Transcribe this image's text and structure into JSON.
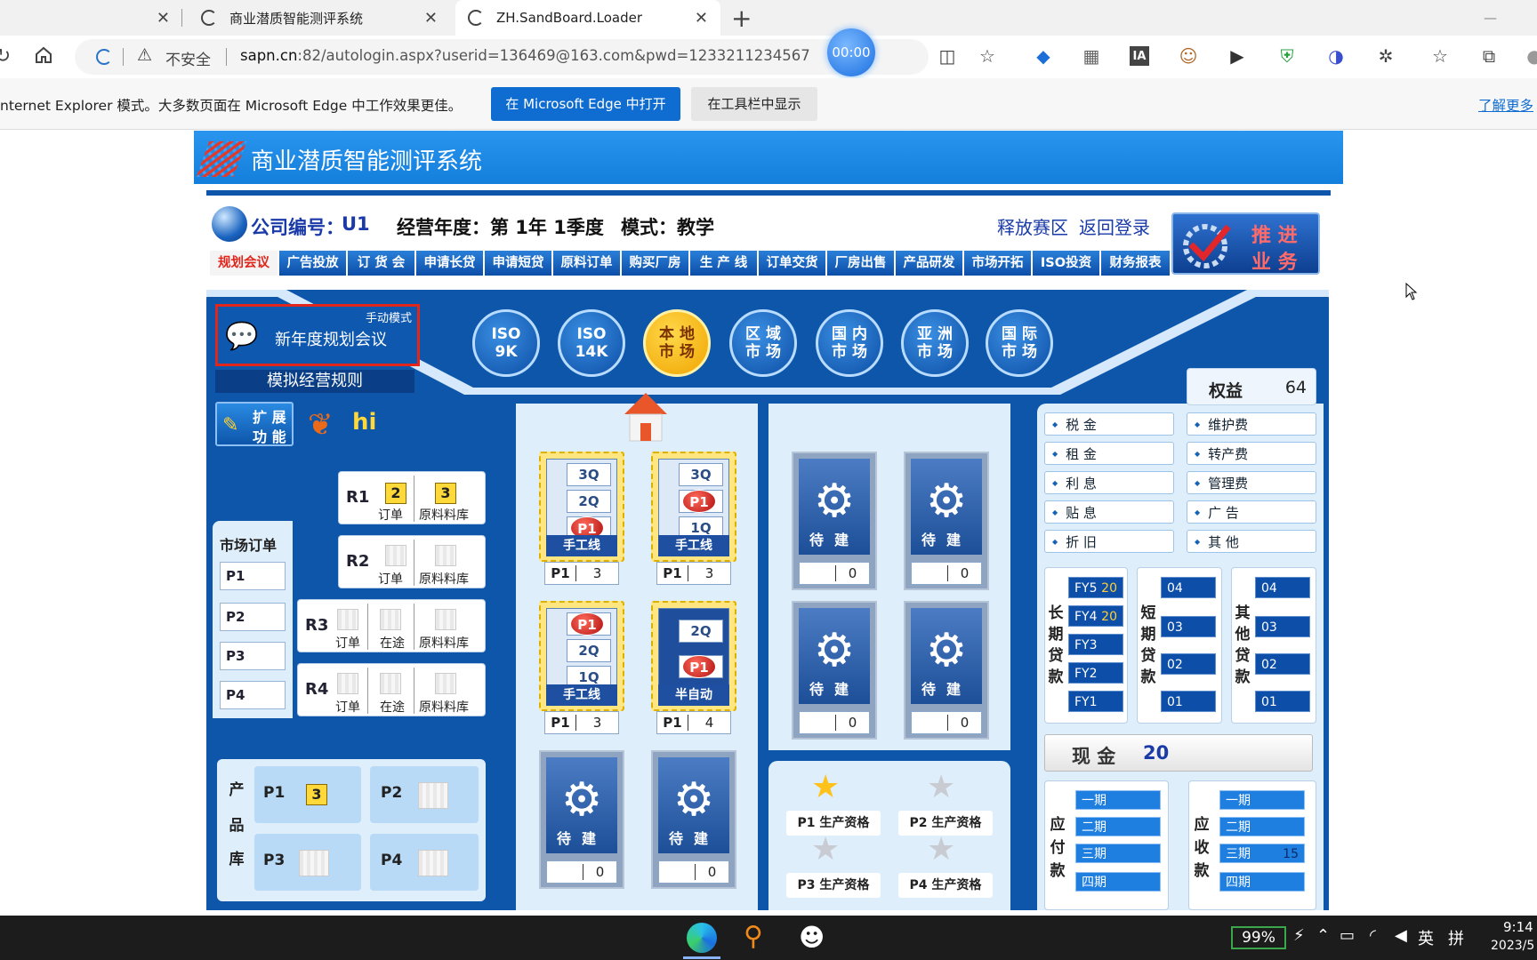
{
  "browser": {
    "tabs": [
      {
        "title": "商业潜质智能测评系统"
      },
      {
        "title": "ZH.SandBoard.Loader"
      }
    ],
    "new_tab": "+",
    "minimize": "—",
    "security_label": "不安全",
    "url_host": "sapn.cn",
    "url_rest": ":82/autologin.aspx?userid=136469@163.com&pwd=1233211234567",
    "timer": "00:00",
    "ie_bar": {
      "message": "nternet Explorer 模式。大多数页面在 Microsoft Edge 中工作效果更佳。",
      "open_edge": "在 Microsoft Edge 中打开",
      "show_toolbar": "在工具栏中显示",
      "learn_more": "了解更多"
    }
  },
  "app": {
    "title": "商业潜质智能测评系统",
    "company_label": "公司编号：",
    "company_id": "U1",
    "year_label": "经营年度：第 1年 1季度",
    "mode_label": "模式：教学",
    "release": "释放赛区",
    "back_login": "返回登录",
    "advance": [
      "推 进",
      "业 务"
    ],
    "menu": [
      "规划会议",
      "广告投放",
      "订 货 会",
      "申请长贷",
      "申请短贷",
      "原料订单",
      "购买厂房",
      "生 产 线",
      "订单交货",
      "厂房出售",
      "产品研发",
      "市场开拓",
      "ISO投资",
      "财务报表"
    ],
    "meeting": {
      "mode": "手动模式",
      "title": "新年度规划会议"
    },
    "rules": "模拟经营规则",
    "extend": [
      "扩 展",
      "功 能"
    ],
    "hi": "hi",
    "markets": [
      {
        "l1": "ISO",
        "l2": "9K"
      },
      {
        "l1": "ISO",
        "l2": "14K"
      },
      {
        "l1": "本 地",
        "l2": "市 场"
      },
      {
        "l1": "区 域",
        "l2": "市 场"
      },
      {
        "l1": "国 内",
        "l2": "市 场"
      },
      {
        "l1": "亚 洲",
        "l2": "市 场"
      },
      {
        "l1": "国 际",
        "l2": "市 场"
      }
    ],
    "market_orders": {
      "title": "市场订单",
      "items": [
        "P1",
        "P2",
        "P3",
        "P4"
      ]
    },
    "orders": {
      "r1": {
        "name": "R1",
        "order": "订单",
        "order_qty": "2",
        "stock": "原料料库",
        "stock_qty": "3"
      },
      "r2": {
        "name": "R2",
        "order": "订单",
        "stock": "原料料库"
      },
      "r3": {
        "name": "R3",
        "order": "订单",
        "transit": "在途",
        "stock": "原料料库"
      },
      "r4": {
        "name": "R4",
        "order": "订单",
        "transit": "在途",
        "stock": "原料料库"
      }
    },
    "product_store": {
      "title": [
        "产",
        "品",
        "库"
      ],
      "p1": "P1",
      "p1_qty": "3",
      "p2": "P2",
      "p3": "P3",
      "p4": "P4"
    },
    "lines": {
      "q3": "3Q",
      "q2": "2Q",
      "q1": "1Q",
      "p1": "P1",
      "manual": "手工线",
      "semi": "半自动",
      "l1_count": "3",
      "l2_count": "3",
      "l3_count": "3",
      "l4_count": "4",
      "pending": "待建",
      "zero": "0"
    },
    "qualifications": [
      "P1 生产资格",
      "P2 生产资格",
      "P3 生产资格",
      "P4 生产资格"
    ],
    "equity": {
      "label": "权益",
      "value": "64"
    },
    "expenses_left": [
      "税 金",
      "租 金",
      "利 息",
      "贴 息",
      "折 旧"
    ],
    "expenses_right": [
      "维护费",
      "转产费",
      "管理费",
      "广 告",
      "其 他"
    ],
    "long_loan": {
      "title": [
        "长",
        "期",
        "贷",
        "款"
      ],
      "items": [
        {
          "label": "FY5",
          "value": "20"
        },
        {
          "label": "FY4",
          "value": "20"
        },
        {
          "label": "FY3",
          "value": ""
        },
        {
          "label": "FY2",
          "value": ""
        },
        {
          "label": "FY1",
          "value": ""
        }
      ]
    },
    "short_loan": {
      "title": [
        "短",
        "期",
        "贷",
        "款"
      ],
      "items": [
        "04",
        "03",
        "02",
        "01"
      ]
    },
    "other_loan": {
      "title": [
        "其",
        "他",
        "贷",
        "款"
      ],
      "items": [
        "04",
        "03",
        "02",
        "01"
      ]
    },
    "cash": {
      "label": "现 金",
      "value": "20"
    },
    "payable": {
      "title": [
        "应",
        "付",
        "款"
      ],
      "items": [
        "一期",
        "二期",
        "三期",
        "四期"
      ]
    },
    "receivable": {
      "title": [
        "应",
        "收",
        "款"
      ],
      "items": [
        "一期",
        "二期",
        "三期",
        "四期"
      ],
      "third_value": "15"
    }
  },
  "taskbar": {
    "battery": "99%",
    "ime": "英",
    "ime2": "拼",
    "time": "9:14",
    "date": "2023/5"
  },
  "colors": {
    "header_blue": "#1f8ae6",
    "panel_blue": "#0d56aa",
    "accent_yellow": "#ffd84a",
    "alert_red": "#e0261c"
  }
}
